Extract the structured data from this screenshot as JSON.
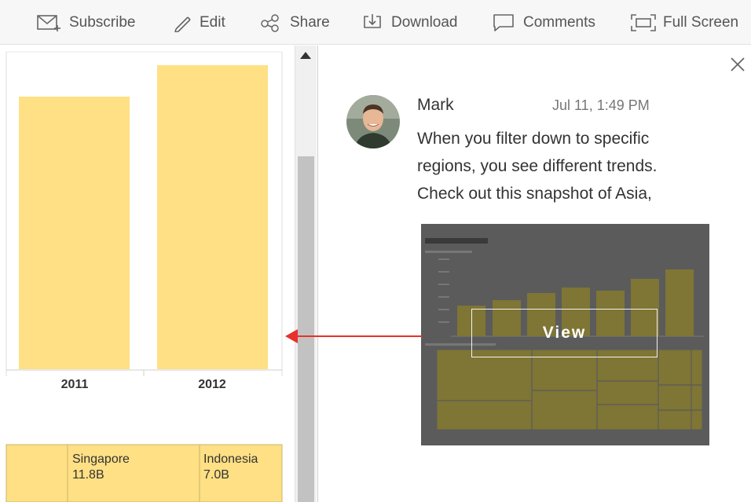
{
  "toolbar": {
    "items": [
      {
        "label": "Subscribe",
        "icon": "subscribe-icon"
      },
      {
        "label": "Edit",
        "icon": "pencil-icon"
      },
      {
        "label": "Share",
        "icon": "share-icon"
      },
      {
        "label": "Download",
        "icon": "download-icon"
      },
      {
        "label": "Comments",
        "icon": "comment-icon"
      },
      {
        "label": "Full Screen",
        "icon": "fullscreen-icon"
      }
    ]
  },
  "viz": {
    "bar_color": "#ffe084",
    "bar_years": [
      "2011",
      "2012"
    ],
    "treemap": [
      {
        "country": "Singapore",
        "value": "11.8B"
      },
      {
        "country": "Indonesia",
        "value": "7.0B"
      }
    ]
  },
  "chart_data": {
    "type": "bar",
    "categories": [
      "2011",
      "2012"
    ],
    "values": [
      0.84,
      0.91
    ],
    "title": "",
    "xlabel": "",
    "ylabel": ""
  },
  "comment": {
    "author": "Mark",
    "time": "Jul 11, 1:49 PM",
    "lines": [
      "When you filter down to specific",
      "regions, you see different trends.",
      "Check out this snapshot of Asia,"
    ],
    "view_label": "View"
  },
  "colors": {
    "accent_arrow": "#e8312c",
    "snapshot_overlay": "#5b5b5b"
  }
}
